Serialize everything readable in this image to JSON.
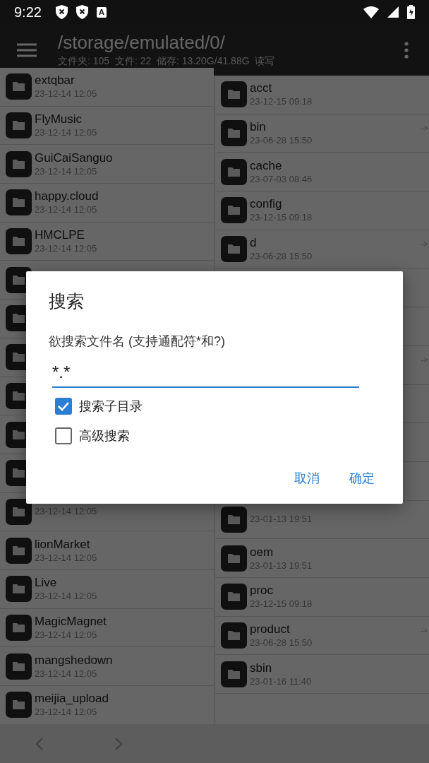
{
  "status_bar": {
    "time": "9:22",
    "app_badge": "A"
  },
  "toolbar": {
    "path": "/storage/emulated/0/",
    "info": "文件夹: 105  文件: 22  储存: 13.20G/41.88G  读写"
  },
  "left_pane": {
    "rows": [
      {
        "kind": "folder",
        "name": "extqbar",
        "date": "23-12-14 12:05"
      },
      {
        "kind": "folder",
        "name": "FlyMusic",
        "date": "23-12-14 12:05"
      },
      {
        "kind": "folder",
        "name": "GuiCaiSanguo",
        "date": "23-12-14 12:05"
      },
      {
        "kind": "folder",
        "name": "happy.cloud",
        "date": "23-12-14 12:05"
      },
      {
        "kind": "folder",
        "name": "HMCLPE",
        "date": "23-12-14 12:05"
      },
      {
        "kind": "folder"
      },
      {
        "kind": "folder"
      },
      {
        "kind": "folder"
      },
      {
        "kind": "folder"
      },
      {
        "kind": "folder"
      },
      {
        "kind": "folder"
      },
      {
        "kind": "folder",
        "date": "23-12-14 12:05"
      },
      {
        "kind": "folder",
        "name": "lionMarket",
        "date": "23-12-14 12:05"
      },
      {
        "kind": "folder",
        "name": "Live",
        "date": "23-12-14 12:05"
      },
      {
        "kind": "folder",
        "name": "MagicMagnet",
        "date": "23-12-14 12:05"
      },
      {
        "kind": "folder",
        "name": "mangshedown",
        "date": "23-12-14 12:05"
      },
      {
        "kind": "folder",
        "name": "meijia_upload",
        "date": "23-12-14 12:05"
      }
    ]
  },
  "right_pane": {
    "rows": [
      {
        "kind": "folder",
        "name": "acct",
        "date": "23-12-15 09:18"
      },
      {
        "kind": "folder",
        "name": "bin",
        "date": "23-06-28 15:50",
        "link": "->"
      },
      {
        "kind": "folder",
        "name": "cache",
        "date": "23-07-03 08:46"
      },
      {
        "kind": "folder",
        "name": "config",
        "date": "23-12-15 09:18"
      },
      {
        "kind": "folder",
        "name": "d",
        "date": "23-06-28 15:50",
        "link": "->"
      },
      {
        "kind": "covered"
      },
      {
        "kind": "covered"
      },
      {
        "kind": "covered",
        "link": "->"
      },
      {
        "kind": "covered"
      },
      {
        "kind": "covered"
      },
      {
        "kind": "covered"
      },
      {
        "kind": "folder",
        "date": "23-01-13 19:51"
      },
      {
        "kind": "folder",
        "name": "oem",
        "date": "23-01-13 19:51"
      },
      {
        "kind": "folder",
        "name": "proc",
        "date": "23-12-15 09:18"
      },
      {
        "kind": "folder",
        "name": "product",
        "date": "23-06-28 15:50",
        "link": "->"
      },
      {
        "kind": "folder",
        "name": "sbin",
        "date": "23-01-16 11:40"
      }
    ]
  },
  "dialog": {
    "title": "搜索",
    "label": "欲搜索文件名 (支持通配符*和?)",
    "value": "*.*",
    "options": [
      {
        "label": "搜索子目录",
        "checked": true
      },
      {
        "label": "高级搜索",
        "checked": false
      }
    ],
    "buttons": [
      "取消",
      "确定"
    ]
  }
}
